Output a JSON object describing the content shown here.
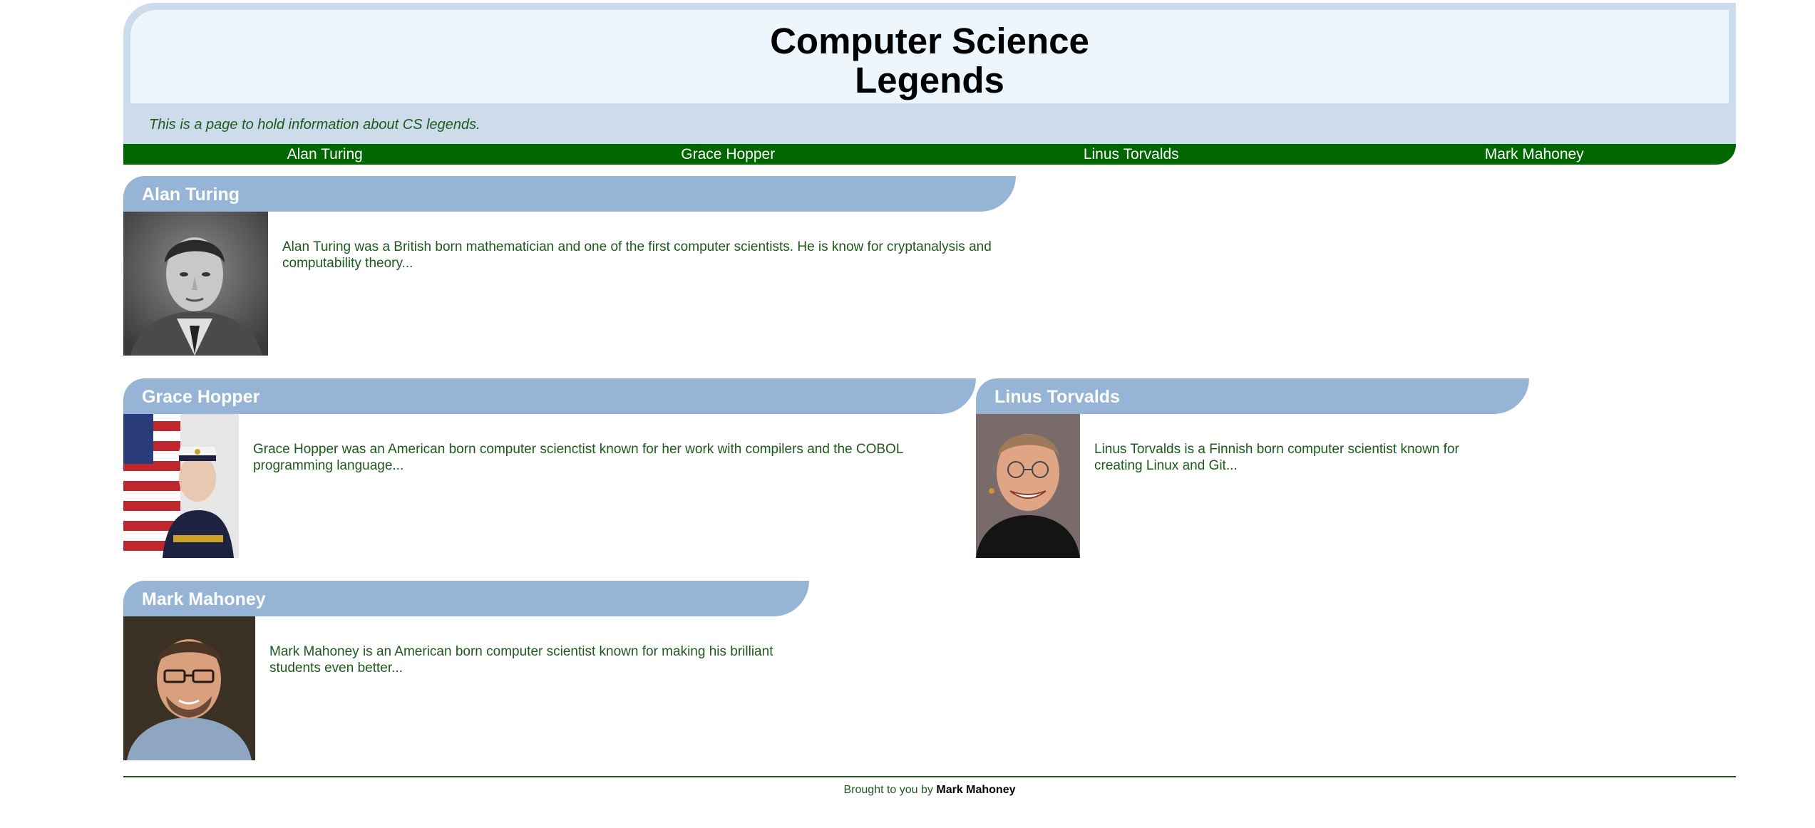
{
  "header": {
    "title": "Computer Science Legends",
    "tagline": "This is a page to hold information about CS legends."
  },
  "nav": {
    "items": [
      {
        "label": "Alan Turing"
      },
      {
        "label": "Grace Hopper"
      },
      {
        "label": "Linus Torvalds"
      },
      {
        "label": "Mark Mahoney"
      }
    ]
  },
  "legends": [
    {
      "name": "Alan Turing",
      "bio": "Alan Turing was a British born mathematician and one of the first computer scientists. He is know for cryptanalysis and computability theory..."
    },
    {
      "name": "Grace Hopper",
      "bio": "Grace Hopper was an American born computer scienctist known for her work with compilers and the COBOL programming language..."
    },
    {
      "name": "Linus Torvalds",
      "bio": "Linus Torvalds is a Finnish born computer scientist known for creating Linux and Git..."
    },
    {
      "name": "Mark Mahoney",
      "bio": "Mark Mahoney is an American born computer scientist known for making his brilliant students even better..."
    }
  ],
  "footer": {
    "prefix": "Brought to you by",
    "author": "Mark Mahoney"
  },
  "colors": {
    "header_bg": "#cddcea",
    "header_inner_bg": "#eef6fd",
    "nav_bg": "#006600",
    "card_head_bg": "#96b4d6",
    "body_text": "#1c5a1c"
  }
}
